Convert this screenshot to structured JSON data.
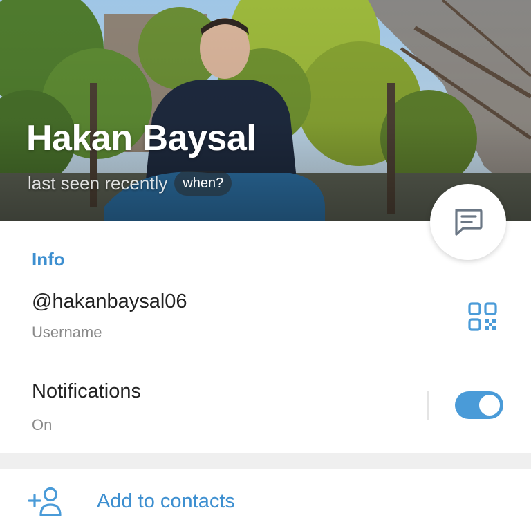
{
  "profile": {
    "name": "Hakan Baysal",
    "status": "last seen recently",
    "when_chip": "when?"
  },
  "info": {
    "section_title": "Info",
    "username_value": "@hakanbaysal06",
    "username_label": "Username",
    "notifications_title": "Notifications",
    "notifications_value": "On",
    "notifications_enabled": true
  },
  "actions": {
    "add_contact_label": "Add to contacts"
  },
  "icons": {
    "fab": "message-icon",
    "qr": "qr-code-icon",
    "add": "add-user-icon"
  },
  "colors": {
    "accent": "#3d8fd0",
    "toggle": "#4a9bd8"
  }
}
